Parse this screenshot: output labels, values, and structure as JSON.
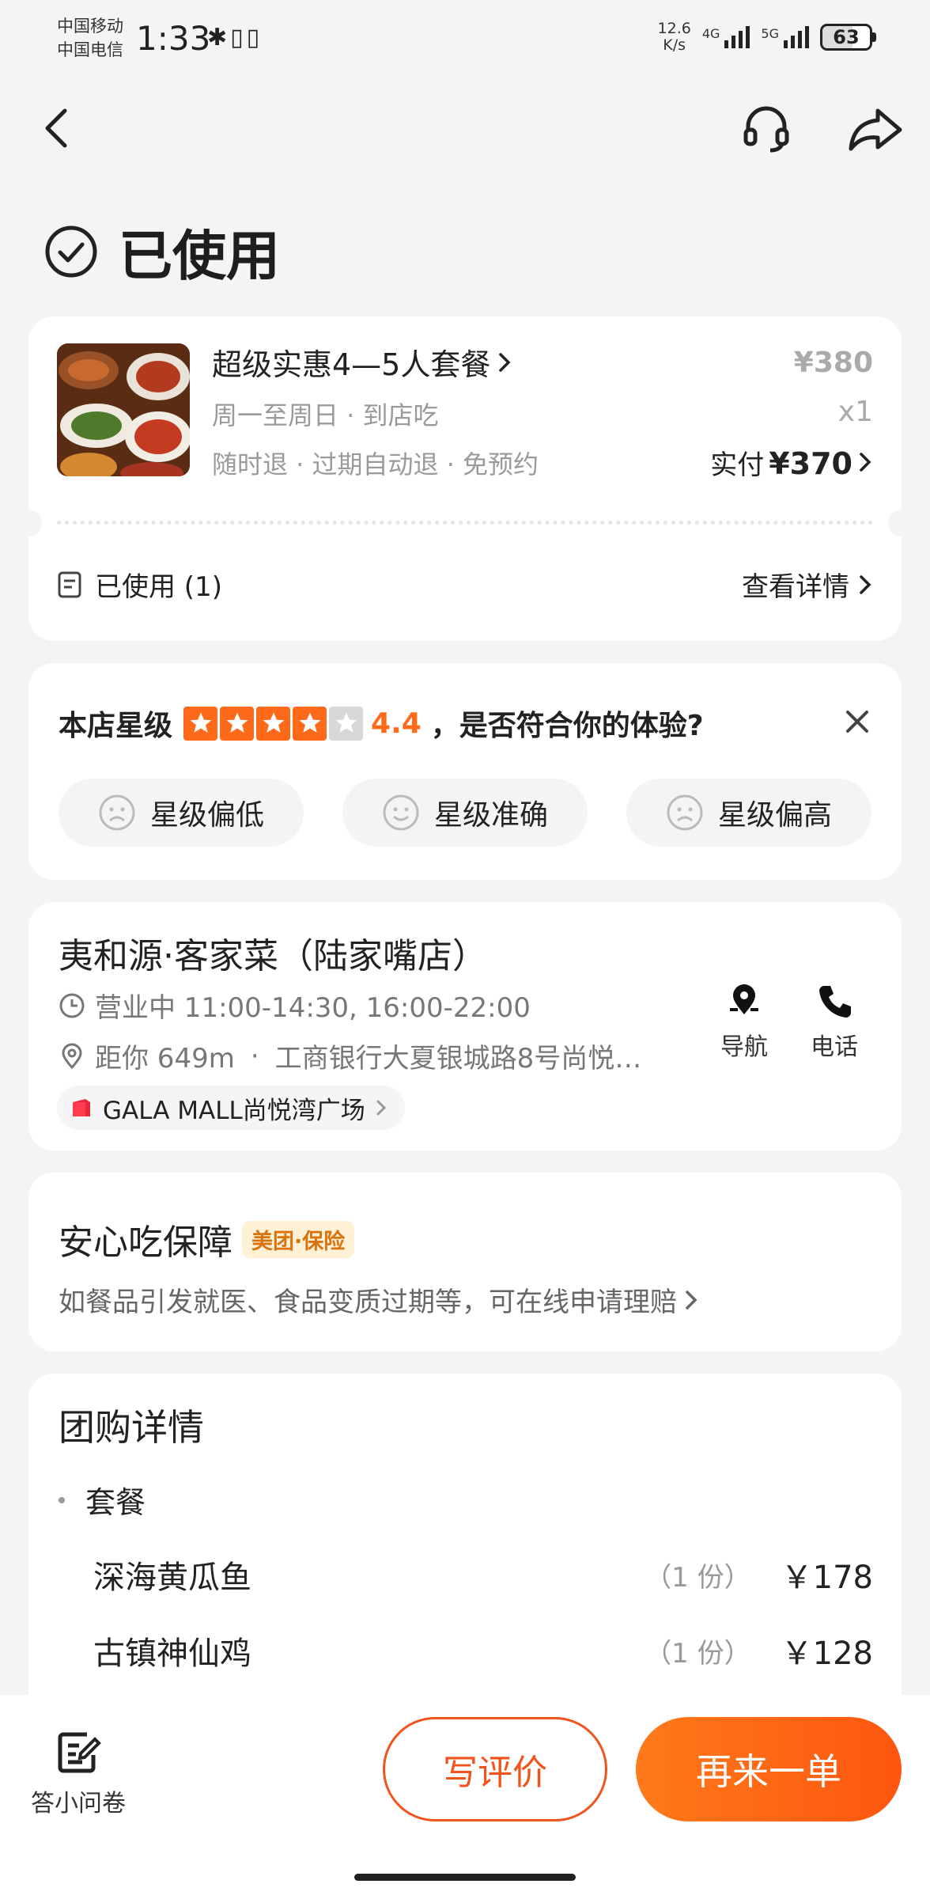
{
  "status_bar": {
    "carrier1": "中国移动",
    "carrier2": "中国电信",
    "time": "1:33",
    "left_icons": "✱▯▯",
    "net_speed_value": "12.6",
    "net_speed_unit": "K/s",
    "sig1_label": "4G",
    "sig2_label": "5G",
    "battery": "63"
  },
  "header": {
    "back_icon": "chevron-left",
    "support_icon": "headset",
    "share_icon": "share-arrow"
  },
  "order_status": "已使用",
  "order": {
    "deal_name": "超级实惠4—5人套餐",
    "sub1": "周一至周日 · 到店吃",
    "sub2": "随时退 · 过期自动退 · 免预约",
    "original_price": "¥380",
    "quantity": "x1",
    "paid_label": "实付",
    "paid_amount": "¥370",
    "used_label": "已使用 (1)",
    "view_detail": "查看详情"
  },
  "rating": {
    "prefix": "本店星级",
    "score": "4.4",
    "question": "，是否符合你的体验?",
    "stars_filled": 4,
    "stars_total": 5,
    "options": [
      "星级偏低",
      "星级准确",
      "星级偏高"
    ]
  },
  "shop": {
    "name": "夷和源·客家菜（陆家嘴店）",
    "hours": "营业中 11:00-14:30, 16:00-22:00",
    "distance": "距你 649m",
    "separator": "·",
    "address": "工商银行大夏银城路8号尚悦…",
    "mall": "GALA MALL尚悦湾广场",
    "nav_label": "导航",
    "phone_label": "电话"
  },
  "guarantee": {
    "title": "安心吃保障",
    "badge": "美团·保险",
    "desc": "如餐品引发就医、食品变质过期等，可在线申请理赔"
  },
  "details": {
    "title": "团购详情",
    "section": "套餐",
    "items": [
      {
        "name": "深海黄瓜鱼",
        "count": "（1 份）",
        "price": "￥178"
      },
      {
        "name": "古镇神仙鸡",
        "count": "（1 份）",
        "price": "￥128"
      }
    ]
  },
  "bottom": {
    "survey_label": "答小问卷",
    "review_button": "写评价",
    "reorder_button": "再来一单"
  },
  "colors": {
    "accent": "#fe5610",
    "star": "#ff6a1a",
    "background": "#f4f4f4"
  }
}
